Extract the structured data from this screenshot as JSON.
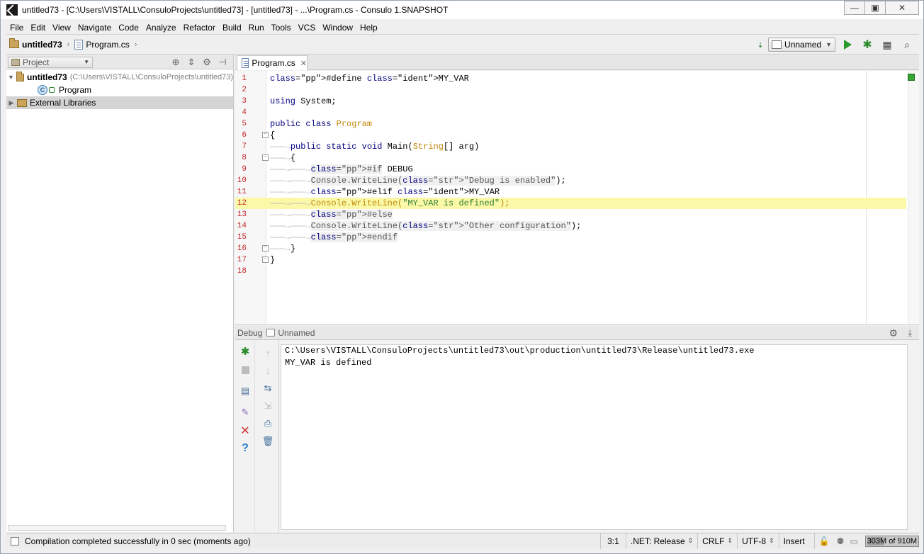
{
  "window": {
    "title": "untitled73 - [C:\\Users\\VISTALL\\ConsuloProjects\\untitled73] - [untitled73] - ...\\Program.cs - Consulo 1.SNAPSHOT",
    "minimize": "▭",
    "maximize": "▣",
    "close": "✕"
  },
  "menu": [
    "File",
    "Edit",
    "View",
    "Navigate",
    "Code",
    "Analyze",
    "Refactor",
    "Build",
    "Run",
    "Tools",
    "VCS",
    "Window",
    "Help"
  ],
  "navbar": {
    "project": "untitled73",
    "file": "Program.cs",
    "run_config": "Unnamed"
  },
  "project_panel": {
    "dropdown": "Project",
    "root_name": "untitled73",
    "root_path": "(C:\\Users\\VISTALL\\ConsuloProjects\\untitled73)",
    "program": "Program",
    "external_libraries": "External Libraries"
  },
  "editor": {
    "tab_label": "Program.cs",
    "lines": [
      {
        "n": "1",
        "text": "#define MY_VAR"
      },
      {
        "n": "2",
        "text": ""
      },
      {
        "n": "3",
        "text": "using System;"
      },
      {
        "n": "4",
        "text": ""
      },
      {
        "n": "5",
        "text": "public class Program"
      },
      {
        "n": "6",
        "text": "{"
      },
      {
        "n": "7",
        "text": "public static void Main(String[] arg)"
      },
      {
        "n": "8",
        "text": "{"
      },
      {
        "n": "9",
        "text": "#if DEBUG"
      },
      {
        "n": "10",
        "text": "Console.WriteLine(\"Debug is enabled\");"
      },
      {
        "n": "11",
        "text": "#elif MY_VAR"
      },
      {
        "n": "12",
        "text": "Console.WriteLine(\"MY_VAR is defined\");"
      },
      {
        "n": "13",
        "text": "#else"
      },
      {
        "n": "14",
        "text": "Console.WriteLine(\"Other configuration\");"
      },
      {
        "n": "15",
        "text": "#endif"
      },
      {
        "n": "16",
        "text": "}"
      },
      {
        "n": "17",
        "text": "}"
      },
      {
        "n": "18",
        "text": ""
      }
    ],
    "highlighted_line": 12
  },
  "debug": {
    "tab": "Debug",
    "config": "Unnamed",
    "console": [
      "C:\\Users\\VISTALL\\ConsuloProjects\\untitled73\\out\\production\\untitled73\\Release\\untitled73.exe",
      "MY_VAR is defined"
    ]
  },
  "status": {
    "message": "Compilation completed successfully in 0 sec (moments ago)",
    "position": "3:1",
    "framework": ".NET: Release",
    "line_sep": "CRLF",
    "encoding": "UTF-8",
    "mode": "Insert",
    "memory": "303M of 910M",
    "memory_used_fraction": 0.33
  },
  "colors": {
    "line_numbers": "#c3262b",
    "highlight": "#fbf9a7",
    "keyword_pp": "#3d7a3d",
    "class_name": "#c0870a",
    "string": "#2e7d32",
    "ok_marker": "#35a535"
  }
}
